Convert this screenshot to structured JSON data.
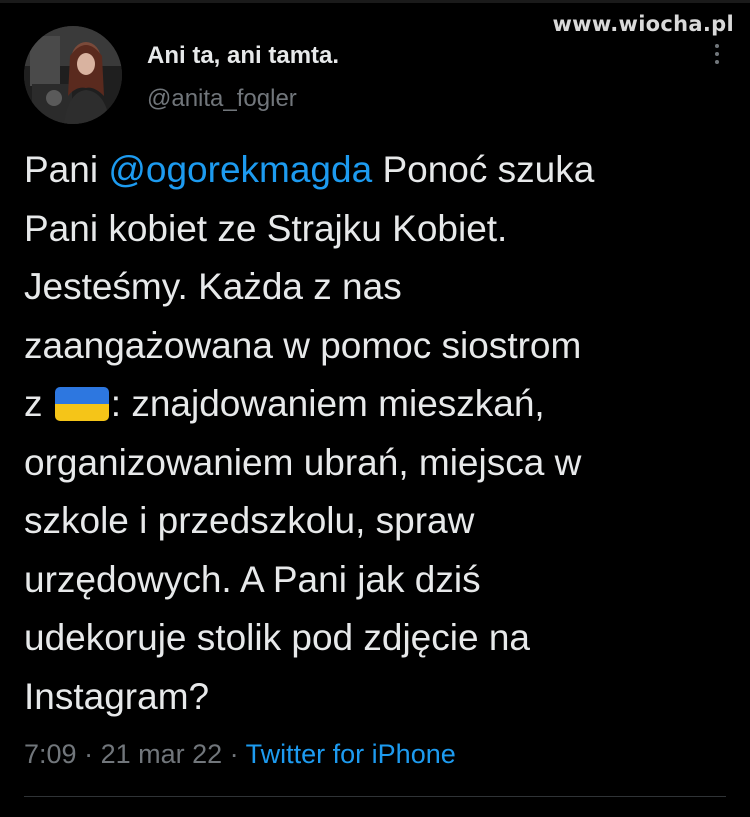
{
  "watermark": "www.wiocha.pl",
  "author": {
    "display_name": "Ani ta, ani tamta.",
    "handle": "@anita_fogler"
  },
  "tweet": {
    "part1": "Pani ",
    "mention": "@ogorekmagda",
    "part2": " Ponoć szuka\nPani kobiet ze Strajku Kobiet.\nJesteśmy. Każda z nas\nzaangażowana w pomoc siostrom\nz ",
    "flag_icon": "ukraine-flag-icon",
    "part3": ": znajdowaniem mieszkań,\norganizowaniem ubrań, miejsca w\nszkole i przedszkolu, spraw\nurzędowych. A Pani jak dziś\nudekoruje stolik pod zdjęcie na\nInstagram?"
  },
  "meta": {
    "time": "7:09",
    "sep1": " · ",
    "date": "21 mar 22",
    "sep2": " · ",
    "source": "Twitter for iPhone"
  },
  "colors": {
    "background": "#000000",
    "text": "#e7e9ea",
    "secondary": "#71767b",
    "accent": "#1d9bf0",
    "flag_blue": "#2d77e0",
    "flag_yellow": "#f5c518"
  }
}
